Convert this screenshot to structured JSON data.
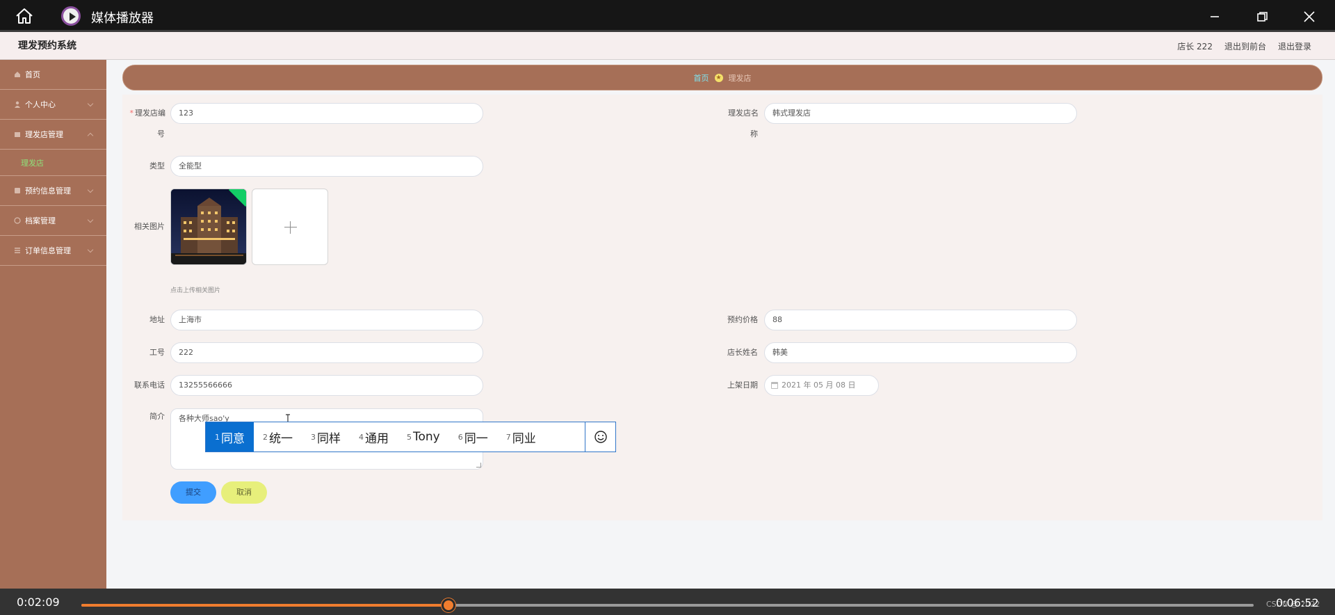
{
  "player": {
    "app_title": "媒体播放器",
    "current_time": "0:02:09",
    "total_time": "0:06:52",
    "progress_fraction": 0.313,
    "watermark": "CSDN @ 2022"
  },
  "header": {
    "system_title": "理发预约系统",
    "user": "店长 222",
    "to_frontend": "退出到前台",
    "logout": "退出登录"
  },
  "sidebar": {
    "items": [
      {
        "label": "首页",
        "icon": "home-icon"
      },
      {
        "label": "个人中心",
        "icon": "user-icon"
      },
      {
        "label": "理发店管理",
        "icon": "shop-icon"
      },
      {
        "label": "预约信息管理",
        "icon": "calendar-icon"
      },
      {
        "label": "档案管理",
        "icon": "archive-icon"
      },
      {
        "label": "订单信息管理",
        "icon": "list-icon"
      }
    ],
    "sub_item": "理发店"
  },
  "breadcrumb": {
    "home": "首页",
    "current": "理发店"
  },
  "form": {
    "shop_no_label_1": "理发店编",
    "shop_no_label_2": "号",
    "shop_no_value": "123",
    "shop_name_label_1": "理发店名",
    "shop_name_label_2": "称",
    "shop_name_value": "韩式理发店",
    "type_label": "类型",
    "type_value": "全能型",
    "image_label": "相关图片",
    "upload_hint": "点击上传相关图片",
    "address_label": "地址",
    "address_value": "上海市",
    "price_label": "预约价格",
    "price_value": "88",
    "staff_no_label": "工号",
    "staff_no_value": "222",
    "manager_label": "店长姓名",
    "manager_value": "韩美",
    "phone_label": "联系电话",
    "phone_value": "13255566666",
    "date_label": "上架日期",
    "date_value": "2021 年 05 月 08 日",
    "intro_label": "简介",
    "intro_value": "各种大师sao'y",
    "submit": "提交",
    "cancel": "取消"
  },
  "ime": {
    "candidates": [
      {
        "n": "1",
        "text": "同意"
      },
      {
        "n": "2",
        "text": "统一"
      },
      {
        "n": "3",
        "text": "同样"
      },
      {
        "n": "4",
        "text": "通用"
      },
      {
        "n": "5",
        "text": "Tony"
      },
      {
        "n": "6",
        "text": "同一"
      },
      {
        "n": "7",
        "text": "同业"
      }
    ]
  },
  "colors": {
    "sidebar": "#a66f57",
    "accent_orange": "#f07d2e",
    "submit_blue": "#409eff",
    "cancel_yellow": "#e7ef7b"
  }
}
